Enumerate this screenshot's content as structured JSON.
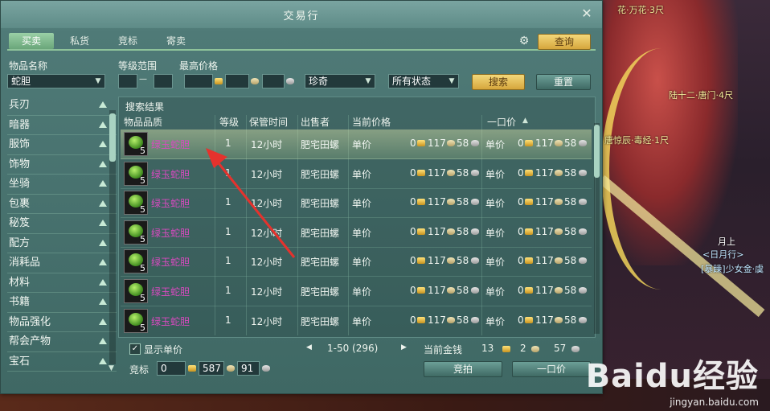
{
  "window": {
    "title": "交易行",
    "close_label": "✕",
    "tabs": [
      {
        "label": "买卖",
        "active": true
      },
      {
        "label": "私货",
        "active": false
      },
      {
        "label": "竞标",
        "active": false
      },
      {
        "label": "寄卖",
        "active": false
      }
    ],
    "query_button": "查询"
  },
  "filters": {
    "item_name_label": "物品名称",
    "item_name_value": "蛇胆",
    "level_range_label": "等级范围",
    "level_dash": "—",
    "max_price_label": "最高价格",
    "quality_value": "珍奇",
    "status_value": "所有状态",
    "search_button": "搜索",
    "reset_button": "重置"
  },
  "categories": [
    "兵刃",
    "暗器",
    "服饰",
    "饰物",
    "坐骑",
    "包裹",
    "秘笈",
    "配方",
    "消耗品",
    "材料",
    "书籍",
    "物品强化",
    "帮会产物",
    "宝石"
  ],
  "results": {
    "title": "搜索结果",
    "columns": [
      "物品品质",
      "等级",
      "保管时间",
      "出售者",
      "当前价格",
      "一口价"
    ],
    "rows": [
      {
        "qty": "5",
        "name": "绿玉蛇胆",
        "level": "1",
        "time": "12小时",
        "seller": "肥宅田螺",
        "price_label": "单价",
        "p_gold": "0",
        "p_silver": "117",
        "p_copper": "58",
        "bo_label": "单价",
        "b_gold": "0",
        "b_silver": "117",
        "b_copper": "58",
        "selected": true
      },
      {
        "qty": "5",
        "name": "绿玉蛇胆",
        "level": "1",
        "time": "12小时",
        "seller": "肥宅田螺",
        "price_label": "单价",
        "p_gold": "0",
        "p_silver": "117",
        "p_copper": "58",
        "bo_label": "单价",
        "b_gold": "0",
        "b_silver": "117",
        "b_copper": "58",
        "selected": false
      },
      {
        "qty": "5",
        "name": "绿玉蛇胆",
        "level": "1",
        "time": "12小时",
        "seller": "肥宅田螺",
        "price_label": "单价",
        "p_gold": "0",
        "p_silver": "117",
        "p_copper": "58",
        "bo_label": "单价",
        "b_gold": "0",
        "b_silver": "117",
        "b_copper": "58",
        "selected": false
      },
      {
        "qty": "5",
        "name": "绿玉蛇胆",
        "level": "1",
        "time": "12小时",
        "seller": "肥宅田螺",
        "price_label": "单价",
        "p_gold": "0",
        "p_silver": "117",
        "p_copper": "58",
        "bo_label": "单价",
        "b_gold": "0",
        "b_silver": "117",
        "b_copper": "58",
        "selected": false
      },
      {
        "qty": "5",
        "name": "绿玉蛇胆",
        "level": "1",
        "time": "12小时",
        "seller": "肥宅田螺",
        "price_label": "单价",
        "p_gold": "0",
        "p_silver": "117",
        "p_copper": "58",
        "bo_label": "单价",
        "b_gold": "0",
        "b_silver": "117",
        "b_copper": "58",
        "selected": false
      },
      {
        "qty": "5",
        "name": "绿玉蛇胆",
        "level": "1",
        "time": "12小时",
        "seller": "肥宅田螺",
        "price_label": "单价",
        "p_gold": "0",
        "p_silver": "117",
        "p_copper": "58",
        "bo_label": "单价",
        "b_gold": "0",
        "b_silver": "117",
        "b_copper": "58",
        "selected": false
      },
      {
        "qty": "5",
        "name": "绿玉蛇胆",
        "level": "1",
        "time": "12小时",
        "seller": "肥宅田螺",
        "price_label": "单价",
        "p_gold": "0",
        "p_silver": "117",
        "p_copper": "58",
        "bo_label": "单价",
        "b_gold": "0",
        "b_silver": "117",
        "b_copper": "58",
        "selected": false
      }
    ]
  },
  "footer": {
    "show_unit_price_label": "显示单价",
    "show_unit_price_checked": "✓",
    "page_range": "1-50 (296)",
    "current_money_label": "当前金钱",
    "money_gold": "13",
    "money_silver": "2",
    "money_copper": "57",
    "bid_label": "竞标",
    "bid_gold": "0",
    "bid_silver": "587",
    "bid_copper": "91",
    "bid_button": "竞拍",
    "buyout_button": "一口价"
  },
  "scene_labels": {
    "top_right": "花·万花·3尺",
    "npc1": "陆十二·唐门·4尺",
    "npc2": "唐惊辰·毒经·1尺",
    "npc3_title": "月上",
    "npc3_tag": "<日月行>",
    "npc3_guild": "[暴躁]少女金·虞"
  },
  "watermark": {
    "brand": "Baidu经验",
    "url": "jingyan.baidu.com"
  }
}
